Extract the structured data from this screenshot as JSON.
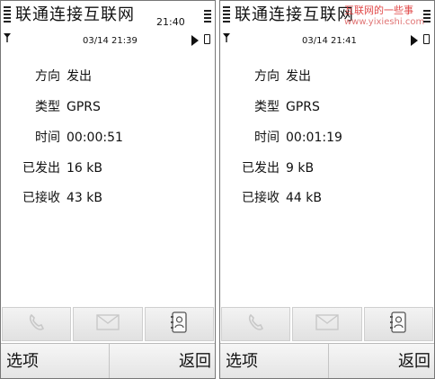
{
  "panels": [
    {
      "title": "联通连接互联网",
      "time": "21:40",
      "date": "03/14 21:39",
      "rows": [
        {
          "label": "方向",
          "value": "发出"
        },
        {
          "label": "类型",
          "value": "GPRS"
        },
        {
          "label": "时间",
          "value": "00:00:51"
        },
        {
          "label": "已发出",
          "value": "16 kB"
        },
        {
          "label": "已接收",
          "value": "43 kB"
        }
      ],
      "softkeys": {
        "left": "选项",
        "right": "返回"
      }
    },
    {
      "title": "联通连接互联网",
      "time": "",
      "date": "03/14 21:41",
      "rows": [
        {
          "label": "方向",
          "value": "发出"
        },
        {
          "label": "类型",
          "value": "GPRS"
        },
        {
          "label": "时间",
          "value": "00:01:19"
        },
        {
          "label": "已发出",
          "value": "9 kB"
        },
        {
          "label": "已接收",
          "value": "44 kB"
        }
      ],
      "softkeys": {
        "left": "选项",
        "right": "返回"
      }
    }
  ],
  "watermark": {
    "line1": "互联网的一些事",
    "line2": "www.yixieshi.com"
  },
  "icons": {
    "antenna": "antenna-icon",
    "play": "play-icon",
    "battery": "battery-icon",
    "phone": "phone-icon",
    "mail": "mail-icon",
    "contacts": "contacts-icon"
  }
}
